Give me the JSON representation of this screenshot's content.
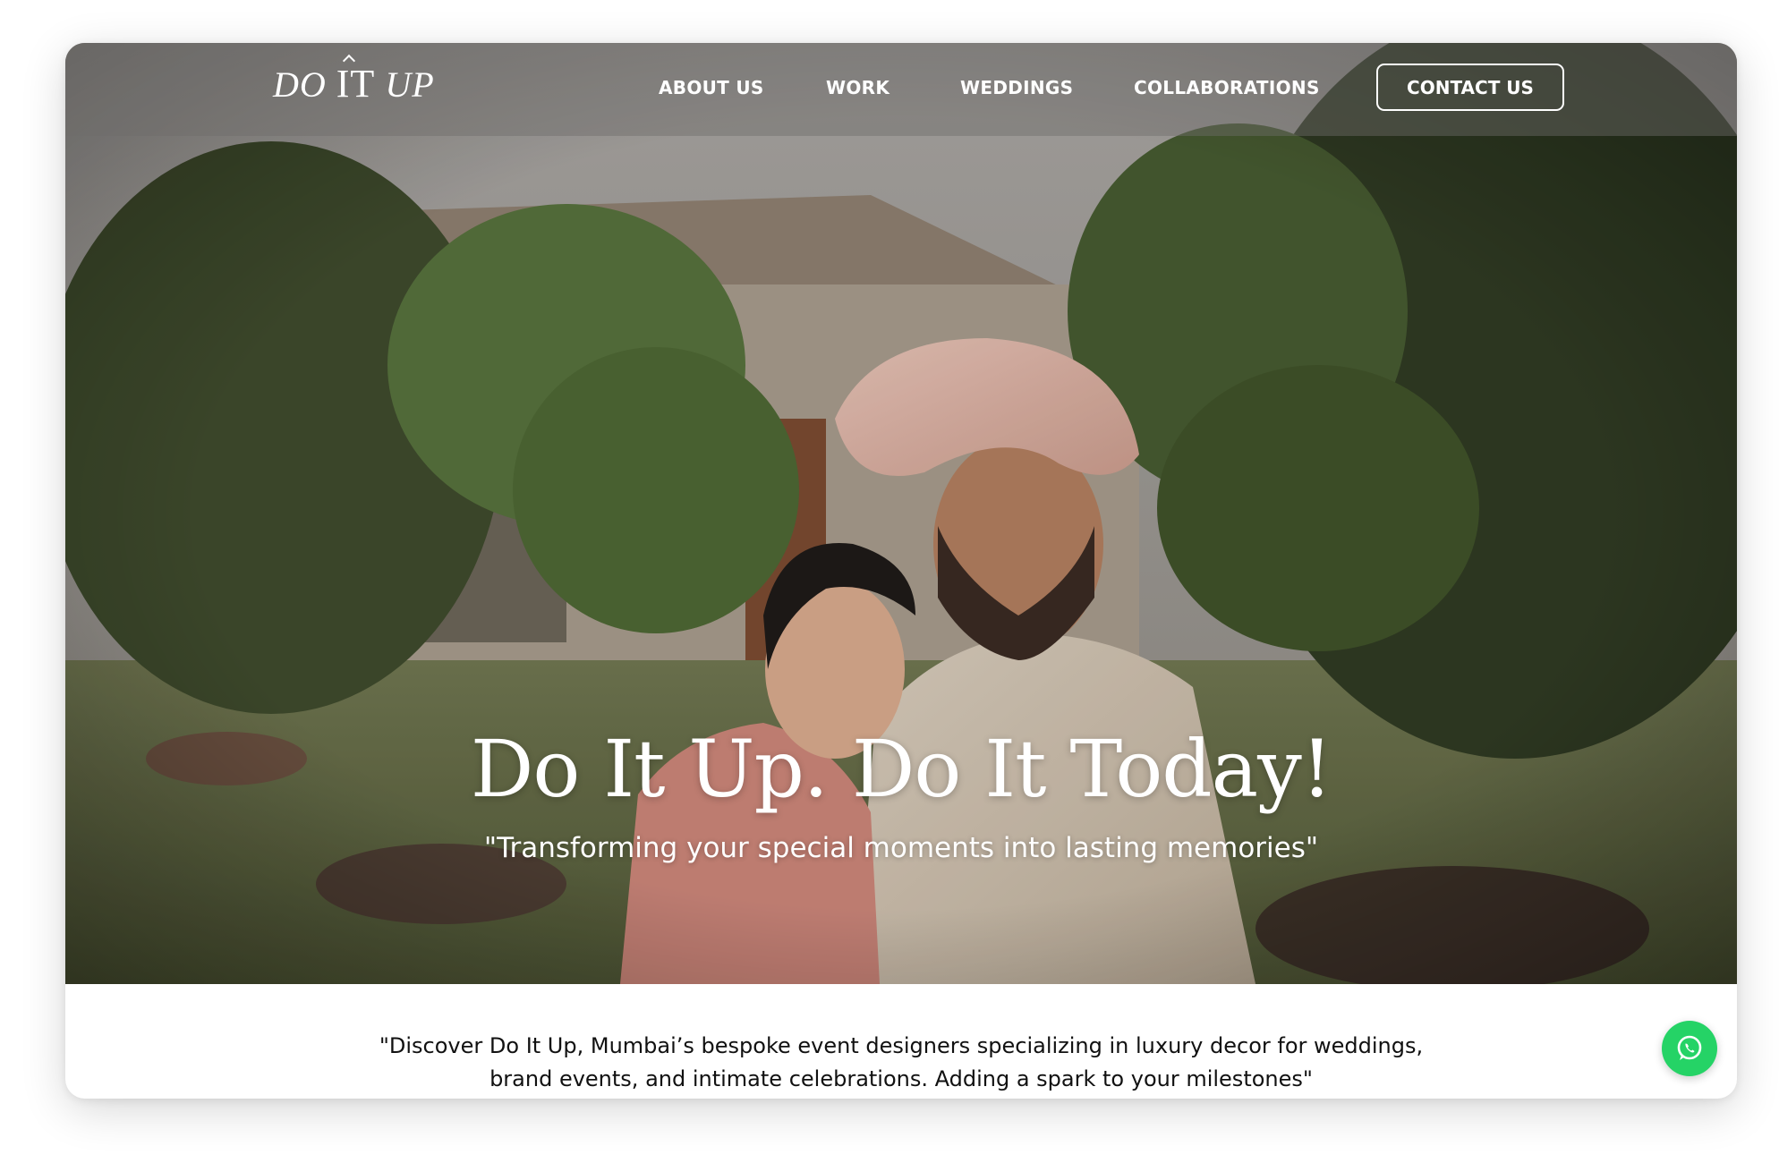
{
  "header": {
    "logo_text": "DO",
    "logo_it": "IT",
    "logo_up": "UP",
    "nav": [
      {
        "label": "ABOUT US"
      },
      {
        "label": "WORK"
      },
      {
        "label": "WEDDINGS"
      },
      {
        "label": "COLLABORATIONS"
      }
    ],
    "contact_label": "CONTACT US"
  },
  "hero": {
    "headline": "Do It Up. Do It Today!",
    "subline": "\"Transforming your special moments into lasting memories\"",
    "image_subject": "wedding-couple-photo"
  },
  "about": {
    "line1": "\"Discover Do It Up, Mumbai’s bespoke event designers specializing in luxury decor for weddings,",
    "line2": "brand events, and intimate celebrations. Adding a spark to your milestones\""
  },
  "floating": {
    "icon": "whatsapp-icon",
    "color": "#25d366"
  },
  "colors": {
    "nav_text": "#ffffff",
    "body_text": "#111111",
    "whatsapp": "#25d366"
  }
}
